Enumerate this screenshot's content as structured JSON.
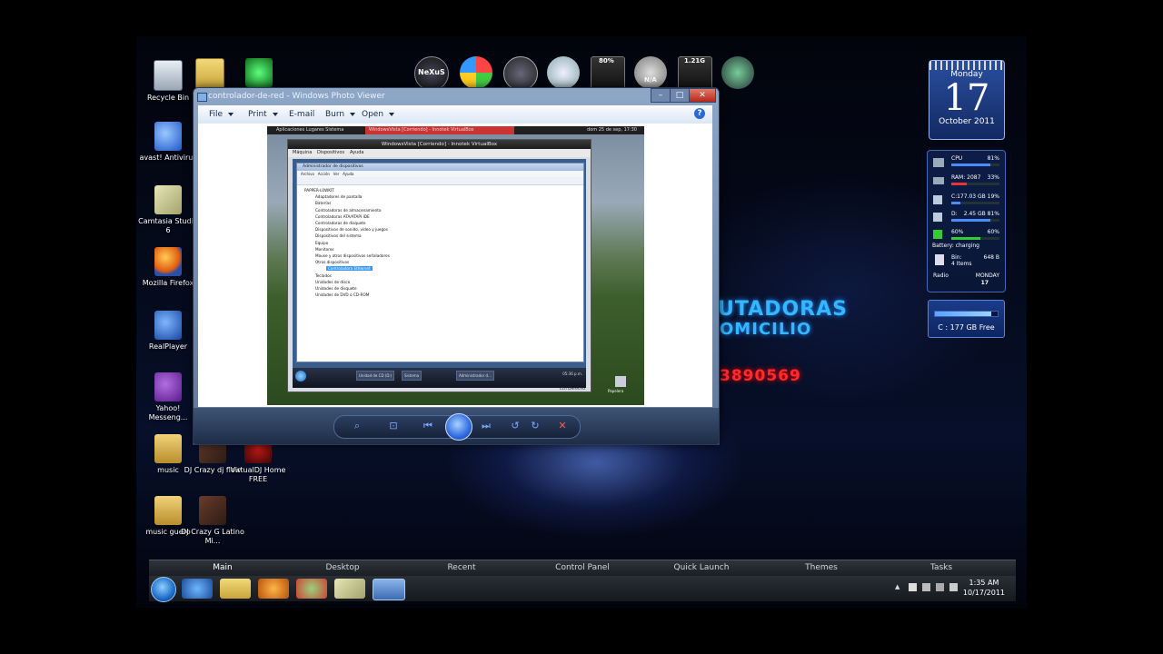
{
  "desktop_icons": [
    {
      "label": "Recycle Bin",
      "icon": "recycle-bin-icon"
    },
    {
      "label": "avast! Antivirus",
      "icon": "avast-icon"
    },
    {
      "label": "Camtasia Studio 6",
      "icon": "camtasia-icon"
    },
    {
      "label": "Mozilla Firefox",
      "icon": "firefox-icon"
    },
    {
      "label": "RealPlayer",
      "icon": "realplayer-icon"
    },
    {
      "label": "Yahoo! Messeng...",
      "icon": "yahoo-messenger-icon"
    },
    {
      "label": "music",
      "icon": "folder-icon"
    },
    {
      "label": "DJ Crazy dj flow",
      "icon": "video-file-icon"
    },
    {
      "label": "VirtualDJ Home FREE",
      "icon": "virtualdj-icon"
    },
    {
      "label": "music guero",
      "icon": "folder-icon"
    },
    {
      "label": "DJ Crazy G Latino Mi...",
      "icon": "video-file-icon"
    }
  ],
  "dock": {
    "labels": {
      "nexus": "NeXuS",
      "cpu_meter": "80%",
      "help": "N/A",
      "ram_meter": "1.21G"
    }
  },
  "calendar": {
    "weekday": "Monday",
    "day": "17",
    "month_year": "October 2011"
  },
  "system_monitor": {
    "cpu_label": "CPU",
    "cpu_value": "81%",
    "cpu_level": 0.81,
    "ram_label": "RAM: 2087",
    "ram_value": "33%",
    "ram_level": 0.33,
    "c_label": "C:",
    "c_value": "177.03 GB 19%",
    "c_level": 0.19,
    "d_label": "D:",
    "d_value": "2.45 GB 81%",
    "d_level": 0.81,
    "battery_value_left": "60%",
    "battery_value_right": "60%",
    "battery_level": 0.6,
    "battery_status": "Battery: charging",
    "bin_label": "Bin:",
    "bin_size": "648 B",
    "bin_items": "4 Items",
    "radio_label": "Radio",
    "weekday": "MONDAY",
    "day": "17"
  },
  "free_space": {
    "text": "C : 177 GB Free",
    "level": 0.9
  },
  "wallpaper_text": {
    "line1": "UTADORAS",
    "line2": "OMICILIO",
    "line3": "3890569"
  },
  "photo_viewer": {
    "title": "controlador-de-red - Windows Photo Viewer",
    "menu": [
      "File",
      "Print",
      "E-mail",
      "Burn",
      "Open"
    ],
    "help": "?",
    "window_buttons": [
      "–",
      "□",
      "✕"
    ]
  },
  "screenshot": {
    "host_topbar": "Aplicaciones   Lugares   Sistema",
    "host_topbar_task": "WindowsVista [Corriendo] - Innotek VirtualBox",
    "host_clock": "dom 25 de sep, 17:30",
    "vbox_title": "WindowsVista [Corriendo] - Innotek VirtualBox",
    "vbox_menu": [
      "Máquina",
      "Dispositivos",
      "Ayuda"
    ],
    "devmgr_title": "Administrador de dispositivos",
    "devmgr_menu": [
      "Archivo",
      "Acción",
      "Ver",
      "Ayuda"
    ],
    "tree": [
      "PAPPER-L0WKIT",
      "Adaptadores de pantalla",
      "Baterías",
      "Controladoras de almacenamiento",
      "Controladoras ATA/ATAPI IDE",
      "Controladoras de disquete",
      "Dispositivos de sonido, vídeo y juegos",
      "Dispositivos del sistema",
      "Equipo",
      "Monitores",
      "Mouse y otros dispositivos señaladores",
      "Otros dispositivos",
      "Controladora Ethernet",
      "Teclados",
      "Unidades de disco",
      "Unidades de disquete",
      "Unidades de DVD o CD-ROM"
    ],
    "selected_index": 12,
    "guest_tasks": [
      "Unidad de CD (D:)",
      "Sistema",
      "Administrador d..."
    ],
    "guest_clock": "05:36 p.m.",
    "vbox_status": "Ctrl Derecho",
    "guest_recycle": "Papelera"
  },
  "taskbar": {
    "tabs": [
      "Main",
      "Desktop",
      "Recent",
      "Control Panel",
      "Quick Launch",
      "Themes",
      "Tasks"
    ],
    "active_tab": "Main",
    "time": "1:35 AM",
    "date": "10/17/2011"
  }
}
